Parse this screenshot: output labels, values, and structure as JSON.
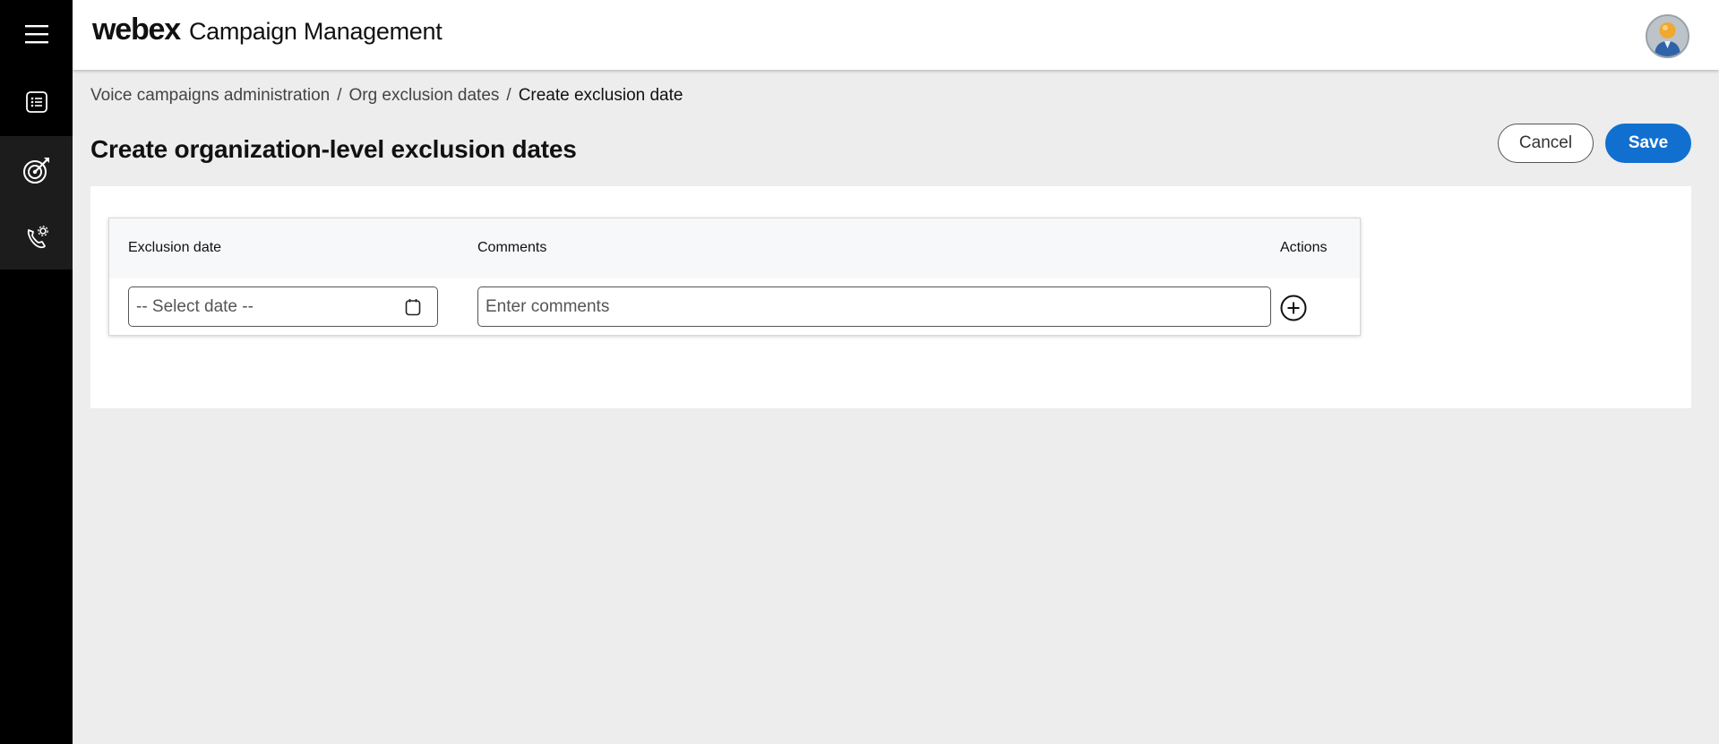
{
  "header": {
    "brand_logo": "webex",
    "app_title": "Campaign Management",
    "avatar_icon": "user-avatar-icon"
  },
  "sidebar": {
    "items": [
      {
        "icon": "hamburger-menu-icon"
      },
      {
        "icon": "list-document-icon"
      },
      {
        "icon": "target-icon"
      },
      {
        "icon": "phone-settings-icon"
      }
    ]
  },
  "breadcrumb": {
    "items": [
      {
        "label": "Voice campaigns administration"
      },
      {
        "label": "Org exclusion dates"
      },
      {
        "label": "Create exclusion date"
      }
    ],
    "separator": "/"
  },
  "page": {
    "title": "Create organization-level exclusion dates"
  },
  "actions": {
    "cancel_label": "Cancel",
    "save_label": "Save"
  },
  "table": {
    "columns": [
      "Exclusion date",
      "Comments",
      "Actions"
    ],
    "row": {
      "date_placeholder": "-- Select date --",
      "comments_placeholder": "Enter comments",
      "comments_value": ""
    }
  },
  "colors": {
    "primary": "#1170cf",
    "sidebar_bg": "#000000",
    "page_bg": "#ededed"
  }
}
